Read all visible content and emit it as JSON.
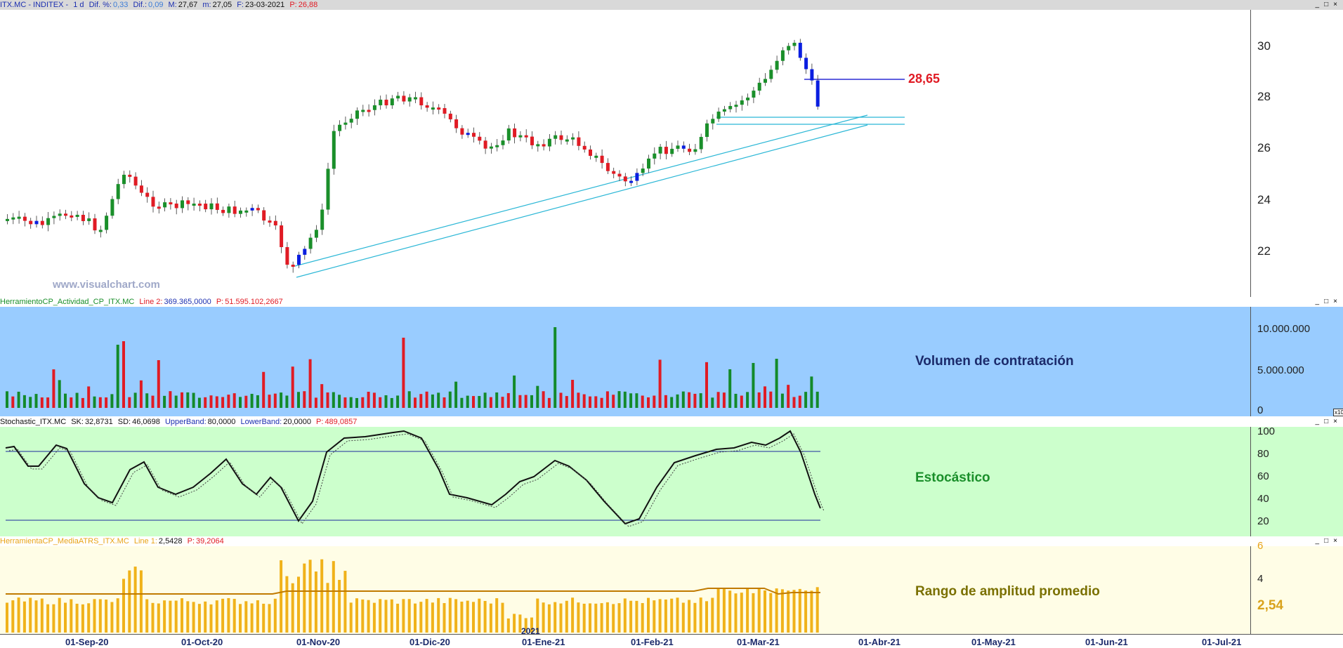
{
  "price_panel": {
    "header": {
      "symbol": "ITX.MC - INDITEX -",
      "period": "1 d",
      "dif_pct_label": "Dif. %:",
      "dif_pct": "0,33",
      "dif_label": "Dif.:",
      "dif": "0,09",
      "max_label": "M:",
      "max": "27,67",
      "min_label": "m:",
      "min": "27,05",
      "date_label": "F:",
      "date": "23-03-2021",
      "price_label": "P:",
      "price": "26,88"
    },
    "level_label": "28,65",
    "watermark": "www.visualchart.com",
    "ticks": [
      "30",
      "28",
      "26",
      "24",
      "22"
    ],
    "colors": {
      "up": "#1a8f2a",
      "down": "#e01b24",
      "highlight": "#0a1ee0",
      "trend": "#2bb7d6",
      "level": "#0000cc"
    }
  },
  "volume_panel": {
    "header": {
      "name": "HerramientoCP_Actividad_CP_ITX.MC",
      "line_label": "Line 2:",
      "line_value": "369.365,0000",
      "p_label": "P:",
      "p_value": "51.595.102,2667"
    },
    "title": "Volumen de contratación",
    "ticks": [
      "10.000.000",
      "5.000.000",
      "0"
    ],
    "scale_badge": "x10",
    "bg": "#99ccff"
  },
  "stoch_panel": {
    "header": {
      "name": "Stochastic_ITX.MC",
      "sk_label": "SK:",
      "sk": "32,8731",
      "sd_label": "SD:",
      "sd": "46,0698",
      "ub_label": "UpperBand:",
      "ub": "80,0000",
      "lb_label": "LowerBand:",
      "lb": "20,0000",
      "p_label": "P:",
      "p": "489,0857"
    },
    "title": "Estocástico",
    "ticks": [
      "100",
      "80",
      "60",
      "40",
      "20"
    ],
    "bg": "#ccffcc"
  },
  "atr_panel": {
    "header": {
      "name": "HerramientaCP_MediaATRS_ITX.MC",
      "line_label": "Line 1:",
      "line_value": "2,5428",
      "p_label": "P:",
      "p_value": "39,2064"
    },
    "title": "Rango de amplitud promedio",
    "ticks": [
      "6",
      "4"
    ],
    "value_label": "2,54",
    "bg": "#fffde6"
  },
  "xaxis": {
    "labels": [
      "01-Sep-20",
      "01-Oct-20",
      "01-Nov-20",
      "01-Dic-20",
      "01-Ene-21",
      "01-Feb-21",
      "01-Mar-21",
      "01-Abr-21",
      "01-May-21",
      "01-Jun-21",
      "01-Jul-21"
    ],
    "year_marker": "2021"
  },
  "window_controls": {
    "minimize": "_",
    "restore": "□",
    "close": "×"
  }
}
